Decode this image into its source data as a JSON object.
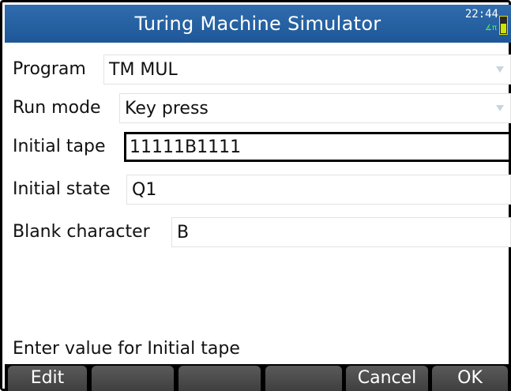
{
  "titlebar": {
    "title": "Turing Machine Simulator",
    "time": "22:44",
    "angle_indicator": "∡π"
  },
  "form": {
    "program": {
      "label": "Program",
      "value": "TM MUL"
    },
    "run_mode": {
      "label": "Run mode",
      "value": "Key press"
    },
    "initial_tape": {
      "label": "Initial tape",
      "value": "11111B1111"
    },
    "initial_state": {
      "label": "Initial state",
      "value": "Q1"
    },
    "blank_char": {
      "label": "Blank character",
      "value": "B"
    }
  },
  "status": {
    "message": "Enter value for Initial tape"
  },
  "softkeys": {
    "k1": "Edit",
    "k2": "",
    "k3": "",
    "k4": "",
    "k5": "Cancel",
    "k6": "OK"
  },
  "colors": {
    "titlebar": "#2463a4",
    "title_text": "#ffffff",
    "softkey": "#4a4a4a",
    "focus_border": "#000000"
  },
  "icons": {
    "battery": "battery-icon",
    "dropdown": "chevron-down-icon"
  }
}
